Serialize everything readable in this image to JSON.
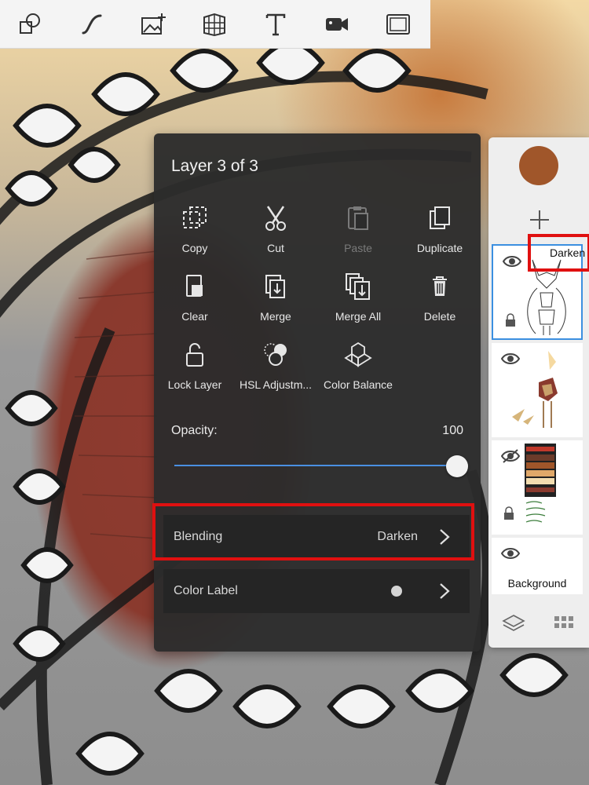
{
  "toolbar": {
    "tools": [
      "shapes-icon",
      "stroke-icon",
      "add-image-icon",
      "perspective-grid-icon",
      "text-icon",
      "video-icon",
      "canvas-frame-icon"
    ]
  },
  "layer_menu": {
    "title": "Layer 3 of 3",
    "actions": [
      {
        "label": "Copy",
        "icon": "copy-icon",
        "enabled": true
      },
      {
        "label": "Cut",
        "icon": "scissors-icon",
        "enabled": true
      },
      {
        "label": "Paste",
        "icon": "paste-icon",
        "enabled": false
      },
      {
        "label": "Duplicate",
        "icon": "duplicate-icon",
        "enabled": true
      },
      {
        "label": "Clear",
        "icon": "clear-icon",
        "enabled": true
      },
      {
        "label": "Merge",
        "icon": "merge-icon",
        "enabled": true
      },
      {
        "label": "Merge All",
        "icon": "merge-all-icon",
        "enabled": true
      },
      {
        "label": "Delete",
        "icon": "trash-icon",
        "enabled": true
      },
      {
        "label": "Lock Layer",
        "icon": "lock-icon",
        "enabled": true
      },
      {
        "label": "HSL Adjustm...",
        "icon": "hsl-icon",
        "enabled": true
      },
      {
        "label": "Color Balance",
        "icon": "color-balance-icon",
        "enabled": true
      }
    ],
    "opacity_label": "Opacity:",
    "opacity_value": "100",
    "opacity_fraction": 1.0,
    "blending_label": "Blending",
    "blending_value": "Darken",
    "color_label": "Color Label"
  },
  "layer_panel": {
    "current_color": "#a0562a",
    "selected_layer_blend": "Darken",
    "background_label": "Background"
  },
  "colors": {
    "slider_accent": "#4a90e2",
    "highlight": "#e01010",
    "selection": "#3b8fe0"
  }
}
